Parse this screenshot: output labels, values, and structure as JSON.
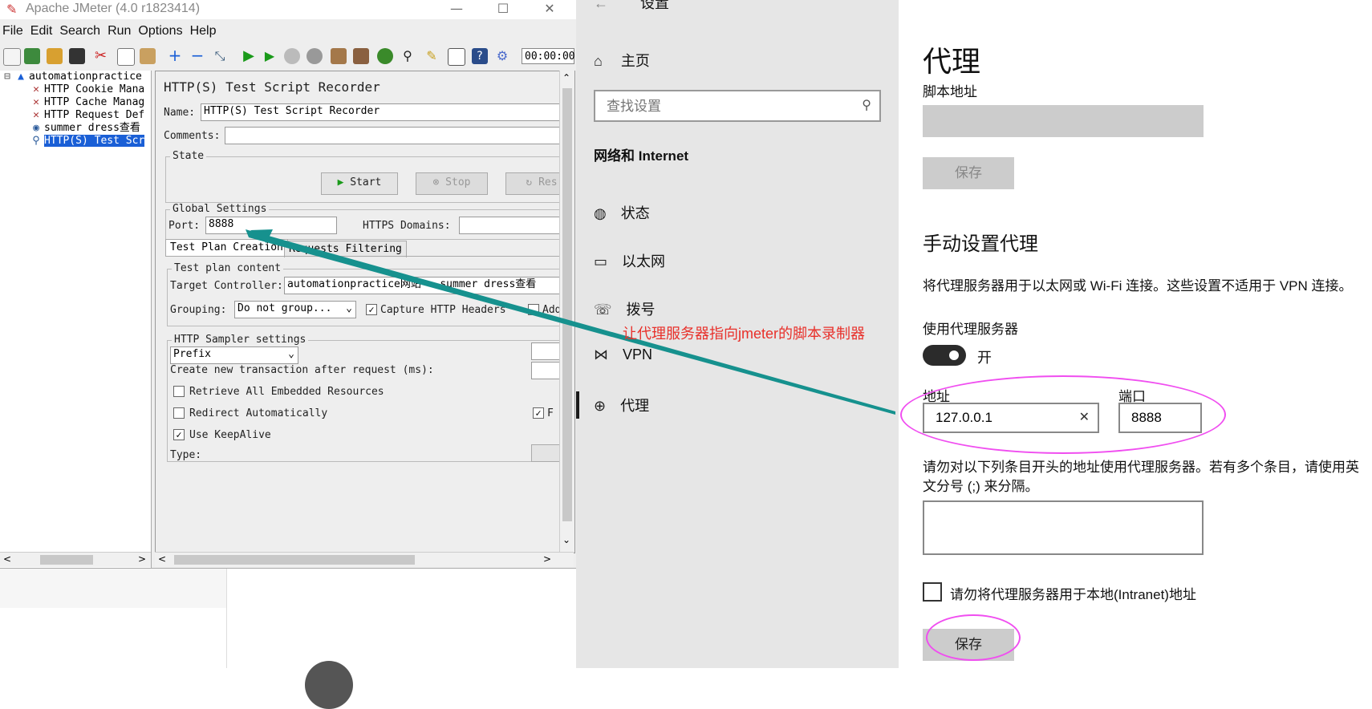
{
  "jmeter": {
    "title": "Apache JMeter (4.0 r1823414)",
    "menu": [
      "File",
      "Edit",
      "Search",
      "Run",
      "Options",
      "Help"
    ],
    "timer": "00:00:00",
    "tree": [
      "automationpractice",
      "HTTP Cookie Mana",
      "HTTP Cache Manag",
      "HTTP Request Def",
      "summer dress查看",
      "HTTP(S) Test Scr"
    ],
    "panel": {
      "title": "HTTP(S) Test Script Recorder",
      "name_label": "Name:",
      "name_value": "HTTP(S) Test Script Recorder",
      "comments_label": "Comments:",
      "state_legend": "State",
      "start": "Start",
      "stop": "Stop",
      "restart": "Res",
      "global_legend": "Global Settings",
      "port_label": "Port:",
      "port_value": "8888",
      "https_label": "HTTPS Domains:",
      "tabs": [
        "Test Plan Creation",
        "Requests Filtering"
      ],
      "plan_legend": "Test plan content",
      "target_label": "Target Controller:",
      "target_value": "automationpractice网站 > summer dress查看",
      "grouping_label": "Grouping:",
      "grouping_value": "Do not group...",
      "capture_label": "Capture HTTP Headers",
      "add_label": "Add",
      "sampler_legend": "HTTP Sampler settings",
      "prefix_value": "Prefix",
      "transaction_label": "Create new transaction after request (ms):",
      "retrieve_label": "Retrieve All Embedded Resources",
      "redirect_label": "Redirect Automatically",
      "follow_label": "F",
      "keepalive_label": "Use KeepAlive",
      "type_label": "Type:"
    }
  },
  "settings": {
    "window_title": "设置",
    "home": "主页",
    "search_placeholder": "查找设置",
    "section": "网络和 Internet",
    "nav": [
      "状态",
      "以太网",
      "拨号",
      "VPN",
      "代理"
    ],
    "page_title": "代理",
    "script_label": "脚本地址",
    "save1": "保存",
    "manual_heading": "手动设置代理",
    "manual_desc": "将代理服务器用于以太网或 Wi-Fi 连接。这些设置不适用于 VPN 连接。",
    "use_proxy_label": "使用代理服务器",
    "toggle_state": "开",
    "address_label": "地址",
    "address_value": "127.0.0.1",
    "port_label": "端口",
    "port_value": "8888",
    "exceptions_line1": "请勿对以下列条目开头的地址使用代理服务器。若有多个条目，请使用英",
    "exceptions_line2": "文分号 (;) 来分隔。",
    "local_label": "请勿将代理服务器用于本地(Intranet)地址",
    "save2": "保存"
  },
  "annotation": {
    "text": "让代理服务器指向jmeter的脚本录制器",
    "color": "#e8302a",
    "arrow_color": "#16918e",
    "ellipse_color": "#f04ef0"
  }
}
